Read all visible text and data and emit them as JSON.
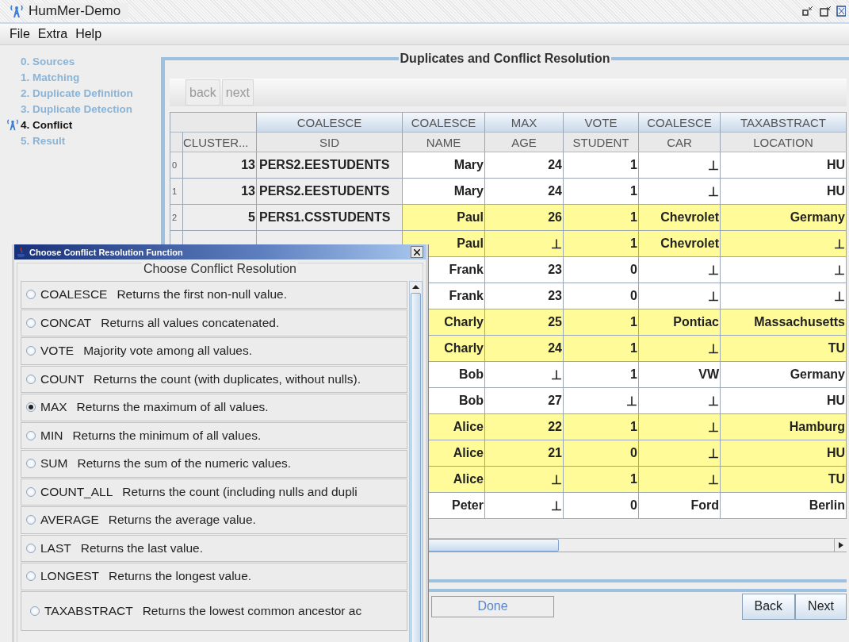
{
  "window": {
    "title": "HumMer-Demo"
  },
  "menu": [
    "File",
    "Extra",
    "Help"
  ],
  "steps": [
    {
      "label": "0. Sources",
      "selected": false
    },
    {
      "label": "1. Matching",
      "selected": false
    },
    {
      "label": "2. Duplicate Definition",
      "selected": false
    },
    {
      "label": "3. Duplicate Detection",
      "selected": false
    },
    {
      "label": "4. Conflict",
      "selected": true
    },
    {
      "label": "5. Result",
      "selected": false
    }
  ],
  "panel": {
    "title": "Duplicates and Conflict Resolution"
  },
  "toolbar": [
    {
      "label": "back",
      "disabled": true
    },
    {
      "label": "next",
      "disabled": true
    }
  ],
  "table": {
    "columns": [
      {
        "name": "CLUSTER..."
      },
      {
        "function": "COALESCE",
        "name": "SID"
      },
      {
        "function": "COALESCE",
        "name": "NAME"
      },
      {
        "function": "MAX",
        "name": "AGE"
      },
      {
        "function": "VOTE",
        "name": "STUDENT"
      },
      {
        "function": "COALESCE",
        "name": "CAR"
      },
      {
        "function": "TAXABSTRACT",
        "name": "LOCATION"
      }
    ],
    "rows": [
      {
        "index": "0",
        "cells": [
          "13",
          "PERS2.EESTUDENTS",
          "Mary",
          "24",
          "1",
          "⊥",
          "HU"
        ],
        "highlighted": false
      },
      {
        "index": "1",
        "cells": [
          "13",
          "PERS2.EESTUDENTS",
          "Mary",
          "24",
          "1",
          "⊥",
          "HU"
        ],
        "highlighted": false
      },
      {
        "index": "2",
        "cells": [
          "5",
          "PERS1.CSSTUDENTS",
          "Paul",
          "26",
          "1",
          "Chevrolet",
          "Germany"
        ],
        "highlighted": true
      },
      {
        "cells": [
          "",
          "",
          "Paul",
          "⊥",
          "1",
          "Chevrolet",
          "⊥"
        ],
        "highlighted": true
      },
      {
        "cells": [
          "",
          "",
          "Frank",
          "23",
          "0",
          "⊥",
          "⊥"
        ],
        "highlighted": false
      },
      {
        "cells": [
          "",
          "",
          "Frank",
          "23",
          "0",
          "⊥",
          "⊥"
        ],
        "highlighted": false
      },
      {
        "cells": [
          "",
          "",
          "Charly",
          "25",
          "1",
          "Pontiac",
          "Massachusetts"
        ],
        "highlighted": true
      },
      {
        "cells": [
          "",
          "",
          "Charly",
          "24",
          "1",
          "⊥",
          "TU"
        ],
        "highlighted": true
      },
      {
        "cells": [
          "",
          "",
          "Bob",
          "⊥",
          "1",
          "VW",
          "Germany"
        ],
        "highlighted": false
      },
      {
        "cells": [
          "",
          "",
          "Bob",
          "27",
          "⊥",
          "⊥",
          "HU"
        ],
        "highlighted": false
      },
      {
        "cells": [
          "",
          "",
          "Alice",
          "22",
          "1",
          "⊥",
          "Hamburg"
        ],
        "highlighted": true
      },
      {
        "cells": [
          "",
          "",
          "Alice",
          "21",
          "0",
          "⊥",
          "HU"
        ],
        "highlighted": true
      },
      {
        "cells": [
          "",
          "",
          "Alice",
          "⊥",
          "1",
          "⊥",
          "TU"
        ],
        "highlighted": true
      },
      {
        "cells": [
          "",
          "",
          "Peter",
          "⊥",
          "0",
          "Ford",
          "Berlin"
        ],
        "highlighted": false
      }
    ]
  },
  "buttons": {
    "done": "Done",
    "back": "Back",
    "next": "Next"
  },
  "dialog": {
    "title": "Choose Conflict Resolution Function",
    "group": "Choose Conflict Resolution",
    "options": [
      {
        "name": "COALESCE",
        "description": "Returns the first non-null value.",
        "selected": false
      },
      {
        "name": "CONCAT",
        "description": "Returns all values concatenated.",
        "selected": false
      },
      {
        "name": "VOTE",
        "description": "Majority vote among all values.",
        "selected": false
      },
      {
        "name": "COUNT",
        "description": "Returns the count (with duplicates, without nulls).",
        "selected": false
      },
      {
        "name": "MAX",
        "description": "Returns the maximum of all values.",
        "selected": true
      },
      {
        "name": "MIN",
        "description": "Returns the minimum of all values.",
        "selected": false
      },
      {
        "name": "SUM",
        "description": "Returns the sum of the numeric values.",
        "selected": false
      },
      {
        "name": "COUNT_ALL",
        "description": "Returns the count (including nulls and dupli",
        "selected": false
      },
      {
        "name": "AVERAGE",
        "description": "Returns the average value.",
        "selected": false
      },
      {
        "name": "LAST",
        "description": "Returns the last value.",
        "selected": false
      },
      {
        "name": "LONGEST",
        "description": "Returns the longest value.",
        "selected": false
      },
      {
        "name": "TAXABSTRACT",
        "description": "Returns the lowest common ancestor ac",
        "selected": false
      }
    ]
  }
}
